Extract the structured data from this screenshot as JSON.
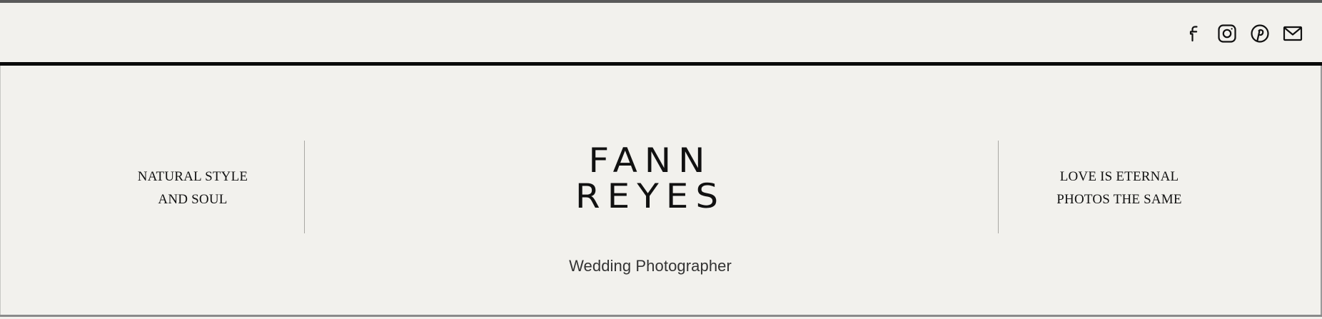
{
  "header": {
    "social": [
      {
        "icon": "facebook-icon",
        "label": "Facebook"
      },
      {
        "icon": "instagram-icon",
        "label": "Instagram"
      },
      {
        "icon": "pinterest-icon",
        "label": "Pinterest"
      },
      {
        "icon": "email-icon",
        "label": "Email"
      }
    ]
  },
  "hero": {
    "left_tagline": [
      "NATURAL STYLE",
      "AND SOUL"
    ],
    "logo": [
      "FANN",
      "REYES"
    ],
    "subtitle": "Wedding Photographer",
    "right_tagline": [
      "LOVE IS ETERNAL",
      "PHOTOS THE SAME"
    ]
  },
  "colors": {
    "background": "#f2f1ed",
    "text": "#111111",
    "rule": "#0a0a0a",
    "divider": "#a9a8a4"
  }
}
